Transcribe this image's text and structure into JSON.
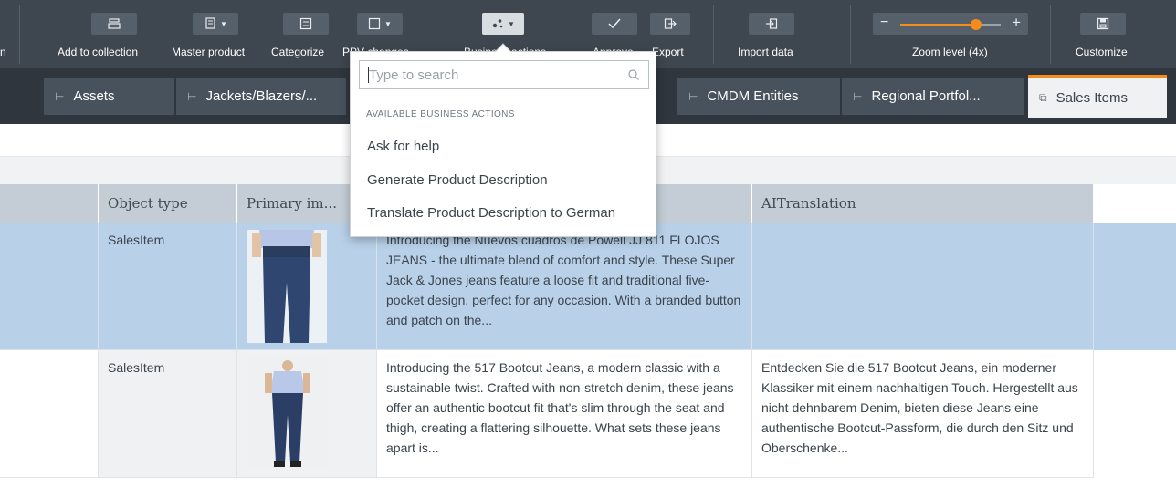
{
  "toolbar": {
    "cut_label": "n",
    "add_to_collection": "Add to collection",
    "master_product": "Master product",
    "categorize": "Categorize",
    "ppv_label": "PPV changes",
    "business_actions": "Business actions",
    "approve": "Approve",
    "export": "Export",
    "import_data": "Import data",
    "zoom_level": "Zoom level (4x)",
    "zoom_value": 0.75,
    "customize": "Customize"
  },
  "tabs": [
    {
      "label": "Assets"
    },
    {
      "label": "Jackets/Blazers/..."
    },
    {
      "label": "CMDM Entities"
    },
    {
      "label": "Regional Portfol..."
    },
    {
      "label": "Sales Items"
    }
  ],
  "grid": {
    "columns": [
      "Object type",
      "Primary im...",
      "AITranslation"
    ],
    "rows": [
      {
        "object_type": "SalesItem",
        "description": "Introducing the Nuevos cuadros de Powell JJ 811 FLOJOS JEANS - the ultimate blend of comfort and style. These Super Jack & Jones jeans feature a loose fit and traditional five-pocket design, perfect for any occasion. With a branded button and patch on the...",
        "translation": ""
      },
      {
        "object_type": "SalesItem",
        "description": "Introducing the 517 Bootcut Jeans, a modern classic with a sustainable twist. Crafted with non-stretch denim, these jeans offer an authentic bootcut fit that's slim through the seat and thigh, creating a flattering silhouette. What sets these jeans apart is...",
        "translation": "Entdecken Sie die 517 Bootcut Jeans, ein moderner Klassiker mit einem nachhaltigen Touch. Hergestellt aus nicht dehnbarem Denim, bieten diese Jeans eine authentische Bootcut-Passform, die durch den Sitz und Oberschenke..."
      }
    ]
  },
  "dropdown": {
    "search_placeholder": "Type to search",
    "section_title": "AVAILABLE BUSINESS ACTIONS",
    "items": [
      "Ask for help",
      "Generate Product Description",
      "Translate Product Description to German"
    ]
  },
  "colors": {
    "toolbar_bg": "#3e464f",
    "tabs_bg": "#2f363d",
    "accent": "#f28c1a",
    "selected_row": "#b8d0e8",
    "header_bg": "#c4cdd5"
  }
}
